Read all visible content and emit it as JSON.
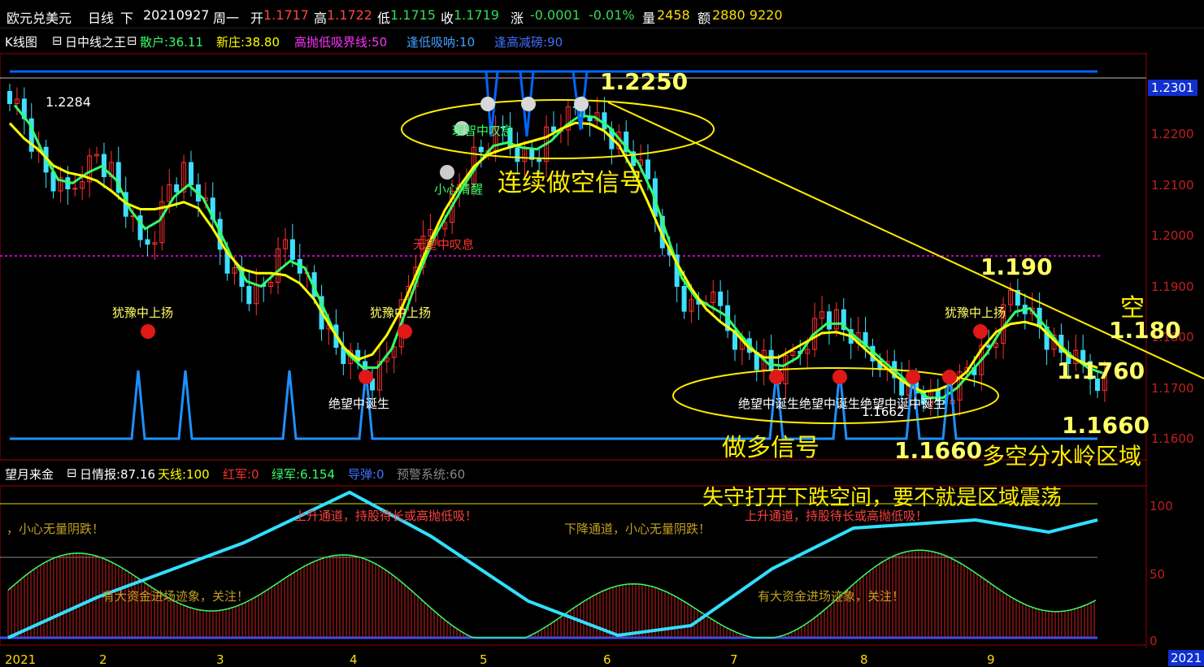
{
  "header": {
    "symbol": "欧元兑美元",
    "period": "日线",
    "direction": "下",
    "date": "20210927",
    "weekday": "周一",
    "open_label": "开",
    "open": "1.1717",
    "high_label": "高",
    "high": "1.1722",
    "low_label": "低",
    "low": "1.1715",
    "close_label": "收",
    "close": "1.1719",
    "chg_label": "涨",
    "chg": "-0.0001",
    "chg_pct": "-0.01%",
    "vol_label": "量",
    "vol": "2458",
    "amt_label": "额",
    "amt": "2880 9220"
  },
  "main_indicator": {
    "k_label": "K线图",
    "ind_name": "日中线之王",
    "param1": "散户:36.11",
    "param2": "新庄:38.80",
    "param3": "高抛低吸界线:50",
    "param4": "逢低吸呐:10",
    "param5": "逢高减磅:90"
  },
  "sub_indicator": {
    "name": "望月来金",
    "p1": "日情报:87.16",
    "p2": "天线:100",
    "p3": "红军:0",
    "p4": "绿军:6.154",
    "p5": "导弹:0",
    "p6": "预警系统:60"
  },
  "price_axis": {
    "current_price": "1.2301",
    "ticks": [
      "1.2200",
      "1.2100",
      "1.2000",
      "1.1900",
      "1.1800",
      "1.1700",
      "1.1600"
    ]
  },
  "sub_axis": {
    "ticks": [
      "100",
      "50",
      "0"
    ]
  },
  "time_axis": {
    "labels": [
      "2021",
      "2",
      "3",
      "4",
      "5",
      "6",
      "7",
      "8",
      "9"
    ],
    "corner_year": "2021"
  },
  "chart_labels": {
    "start_price": "1.2284",
    "low_price": "1.1662",
    "hesitate1": "犹豫中上扬",
    "hesitate2": "犹豫中上扬",
    "hesitate3": "犹豫中上扬",
    "despair1": "绝望中诞生",
    "despair_group": "绝望中诞生绝望中诞生绝望中诞中诞生",
    "careful": "小心清醒",
    "top_text": "理智中叹息",
    "hope": "无望中叹息",
    "sub_msg1": "，小心无量阴跌！",
    "sub_msg2": "上升通道，持股待长或高抛低吸！",
    "sub_msg3": "下降通道，小心无量阴跌！",
    "sub_msg4": "上升通道，持股待长或高抛低吸！",
    "sub_msg5": "有大资金进场迹象，关注！",
    "sub_msg6": "有大资金进场迹象，关注！"
  },
  "annotations": {
    "top_price": "1.2250",
    "short_signal": "连续做空信号",
    "long_signal": "做多信号",
    "p1190": "1.190",
    "kong": "空",
    "p1180": "1.180",
    "p1760": "1.1760",
    "p1660a": "1.1660",
    "p1660b": "1.1660",
    "zone": "多空分水岭区域",
    "conclusion": "失守打开下跌空间，要不就是区域震荡"
  },
  "colors": {
    "up": "#ff3030",
    "down": "#3fe0ff",
    "yellow": "#ffff00",
    "green": "#33ff66",
    "blue": "#0066ff",
    "magenta": "#ff00ff"
  },
  "chart_data": [
    {
      "type": "candlestick",
      "title": "",
      "ylim": [
        1.16,
        1.232
      ],
      "x_months": [
        "2021",
        "2",
        "3",
        "4",
        "5",
        "6",
        "7",
        "8",
        "9"
      ],
      "key_levels": [
        1.2284,
        1.225,
        1.1662,
        1.166
      ],
      "close_series": [
        1.2284,
        1.223,
        1.215,
        1.21,
        1.208,
        1.213,
        1.216,
        1.212,
        1.205,
        1.198,
        1.201,
        1.21,
        1.212,
        1.208,
        1.202,
        1.195,
        1.19,
        1.188,
        1.192,
        1.198,
        1.195,
        1.188,
        1.18,
        1.176,
        1.174,
        1.172,
        1.176,
        1.185,
        1.195,
        1.2,
        1.205,
        1.21,
        1.215,
        1.218,
        1.22,
        1.217,
        1.215,
        1.219,
        1.222,
        1.224,
        1.225,
        1.221,
        1.218,
        1.215,
        1.21,
        1.2,
        1.19,
        1.185,
        1.188,
        1.185,
        1.18,
        1.177,
        1.175,
        1.172,
        1.176,
        1.18,
        1.185,
        1.183,
        1.18,
        1.177,
        1.176,
        1.172,
        1.17,
        1.168,
        1.1662,
        1.17,
        1.174,
        1.176,
        1.18,
        1.188,
        1.187,
        1.182,
        1.178,
        1.176,
        1.174,
        1.1719
      ]
    },
    {
      "type": "bar",
      "title": "",
      "ylim": [
        0,
        100
      ],
      "reference_lines": [
        100,
        60,
        0
      ]
    }
  ]
}
